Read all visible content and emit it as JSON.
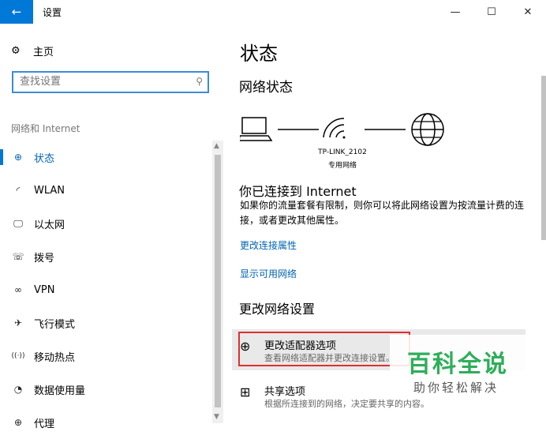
{
  "window": {
    "title": "设置",
    "back_icon": "←",
    "minimize_icon": "—",
    "maximize_icon": "☐",
    "close_icon": "✕"
  },
  "sidebar": {
    "home_label": "主页",
    "home_icon": "⚙",
    "search_placeholder": "查找设置",
    "search_icon": "⚲",
    "section_label": "网络和 Internet",
    "items": [
      {
        "label": "状态",
        "icon": "⊕",
        "active": true
      },
      {
        "label": "WLAN",
        "icon": "◜",
        "active": false
      },
      {
        "label": "以太网",
        "icon": "🖵",
        "active": false
      },
      {
        "label": "拨号",
        "icon": "☏",
        "active": false
      },
      {
        "label": "VPN",
        "icon": "∞",
        "active": false
      },
      {
        "label": "飞行模式",
        "icon": "✈",
        "active": false
      },
      {
        "label": "移动热点",
        "icon": "((·))",
        "active": false
      },
      {
        "label": "数据使用量",
        "icon": "◔",
        "active": false
      },
      {
        "label": "代理",
        "icon": "⊕",
        "active": false
      }
    ]
  },
  "main": {
    "page_title": "状态",
    "network_status": "网络状态",
    "router_name": "TP-LINK_2102",
    "router_type": "专用网络",
    "connected_title": "你已连接到 Internet",
    "connected_desc": "如果你的流量套餐有限制，则你可以将此网络设置为按流量计费的连接，或者更改其他属性。",
    "link_change_props": "更改连接属性",
    "link_show_networks": "显示可用网络",
    "change_settings": "更改网络设置",
    "options": [
      {
        "title": "更改适配器选项",
        "desc": "查看网络适配器并更改连接设置。",
        "icon": "⊕"
      },
      {
        "title": "共享选项",
        "desc": "根据所连接到的网络，决定要共享的内容。",
        "icon": "⊞"
      }
    ]
  },
  "watermark": {
    "title": "百科全说",
    "subtitle": "助你轻松解决"
  },
  "colors": {
    "accent": "#0078d7",
    "link": "#0063b1",
    "highlight_border": "#e03030",
    "watermark_green": "#2eae5a"
  }
}
